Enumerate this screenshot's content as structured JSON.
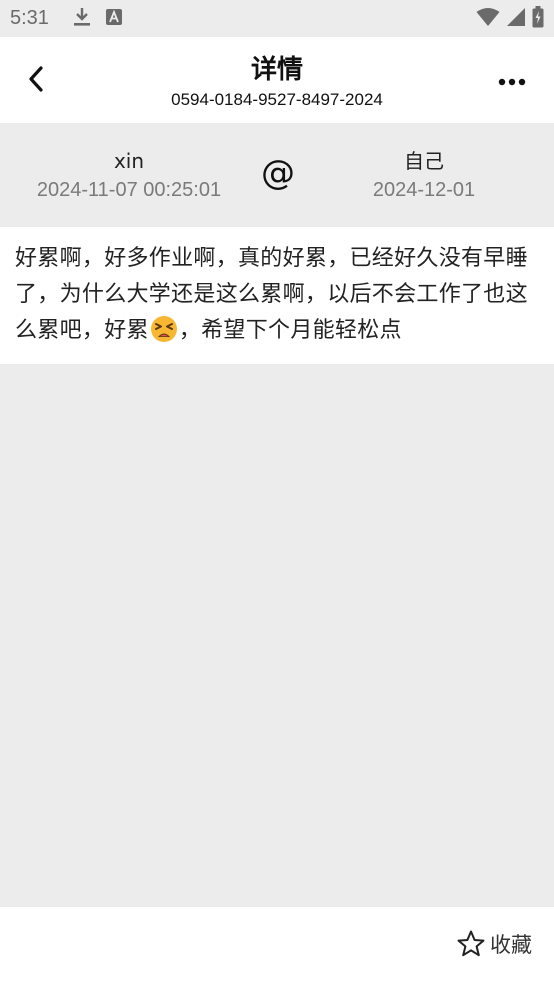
{
  "status_bar": {
    "time": "5:31"
  },
  "header": {
    "title": "详情",
    "subtitle": "0594-0184-9527-8497-2024"
  },
  "info": {
    "left_name": "xin",
    "left_date": "2024-11-07 00:25:01",
    "at_symbol": "@",
    "right_name": "自己",
    "right_date": "2024-12-01"
  },
  "content": {
    "text_before": "好累啊，好多作业啊，真的好累，已经好久没有早睡了，为什么大学还是这么累啊，以后不会工作了也这么累吧，好累",
    "emoji": "tired-face",
    "text_after": "，希望下个月能轻松点"
  },
  "bottom": {
    "favorite_label": "收藏"
  },
  "colors": {
    "background": "#ececec",
    "card": "#ffffff",
    "text_primary": "#111111",
    "text_secondary": "#7a7a7a"
  }
}
